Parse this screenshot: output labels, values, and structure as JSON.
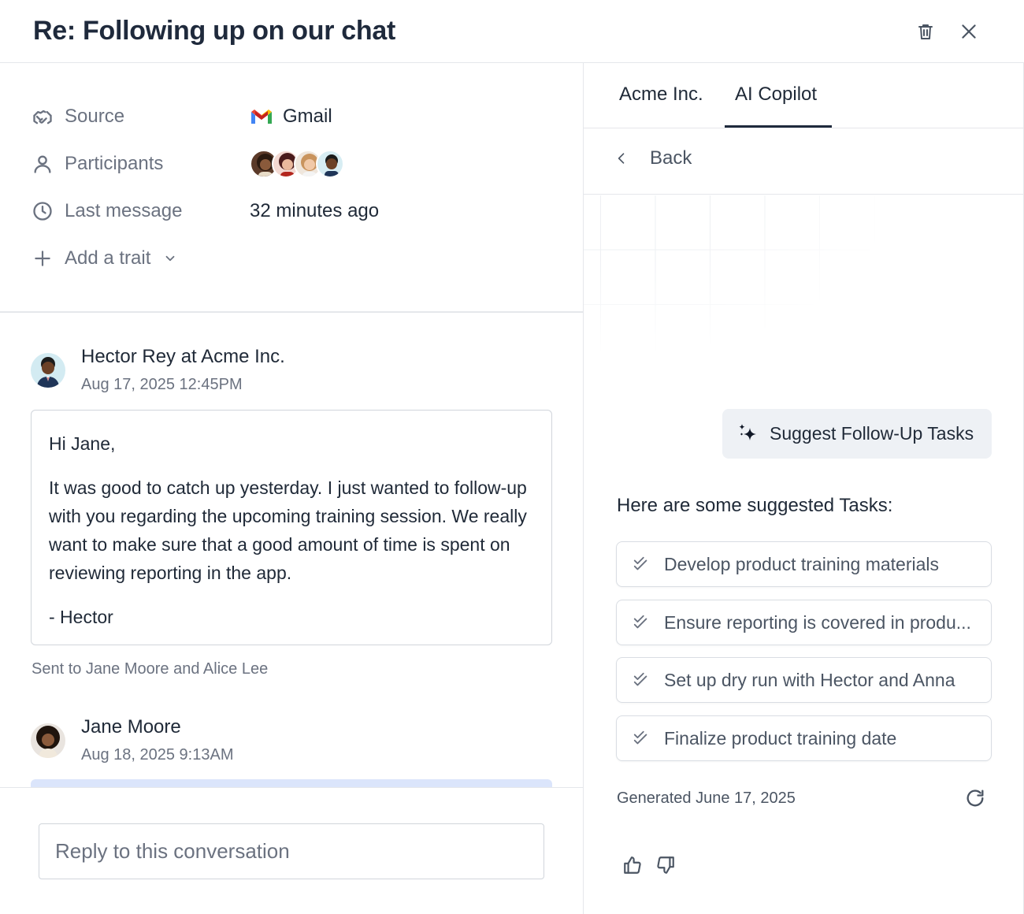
{
  "header": {
    "title": "Re: Following up on our chat"
  },
  "traits": {
    "source_label": "Source",
    "source_value": "Gmail",
    "participants_label": "Participants",
    "last_message_label": "Last message",
    "last_message_value": "32 minutes ago",
    "add_trait_label": "Add a trait"
  },
  "messages": [
    {
      "author": "Hector Rey at Acme Inc.",
      "date": "Aug 17, 2025 12:45PM",
      "body": {
        "greeting": "Hi Jane,",
        "paragraph": "It was good to catch up yesterday. I just wanted to follow-up with you regarding the upcoming training session. We really want to make sure that a good amount of time is spent on reviewing reporting in the app.",
        "signature": "- Hector"
      },
      "sent_to": "Sent to Jane Moore and Alice Lee"
    },
    {
      "author": "Jane Moore",
      "date": "Aug 18, 2025 9:13AM"
    }
  ],
  "reply": {
    "placeholder": "Reply to this conversation"
  },
  "panel": {
    "tabs": [
      {
        "label": "Acme Inc.",
        "active": false
      },
      {
        "label": "AI Copilot",
        "active": true
      }
    ],
    "back_label": "Back",
    "suggest_button": "Suggest Follow-Up Tasks",
    "tasks_heading": "Here are some suggested Tasks:",
    "tasks": [
      {
        "label": "Develop product training materials"
      },
      {
        "label": "Ensure reporting is covered in produ..."
      },
      {
        "label": "Set up dry run with Hector and Anna"
      },
      {
        "label": "Finalize product training date"
      }
    ],
    "generated": "Generated June 17, 2025"
  },
  "icons": {
    "delete": "trash-icon",
    "close": "close-icon",
    "source": "handshake-icon",
    "participants": "user-icon",
    "last_message": "clock-icon",
    "add_trait": "plus-icon",
    "back": "chevron-left-icon",
    "suggest": "sparkles-icon",
    "task": "double-check-icon",
    "refresh": "refresh-icon",
    "like": "thumbs-up-icon",
    "dislike": "thumbs-down-icon"
  },
  "colors": {
    "title": "#1f2a3c",
    "muted_text": "#6b7280",
    "border": "#e5e7eb",
    "suggest_bg": "#eef1f5",
    "peek_bar": "#dbe5fb"
  }
}
